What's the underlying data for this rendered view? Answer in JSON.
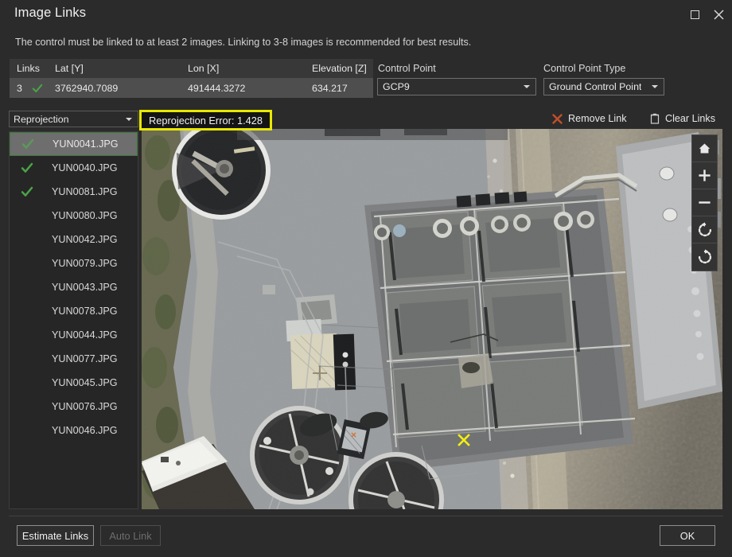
{
  "window": {
    "title": "Image Links",
    "maximize_icon": "maximize-icon",
    "close_icon": "close-icon"
  },
  "instruction": "The control must be linked to at least 2 images. Linking to 3-8 images is recommended for best results.",
  "table": {
    "headers": [
      "Links",
      "Lat [Y]",
      "Lon [X]",
      "Elevation [Z]"
    ],
    "row": {
      "links": "3",
      "lat": "3762940.7089",
      "lon": "491444.3272",
      "elevation": "634.217",
      "check_icon": "check-icon"
    }
  },
  "control_point": {
    "label": "Control Point",
    "value": "GCP9"
  },
  "control_point_type": {
    "label": "Control Point Type",
    "value": "Ground Control Point"
  },
  "toolbar": {
    "view_mode": "Reprojection",
    "reprojection_error": "Reprojection Error: 1.428",
    "remove_link": "Remove Link",
    "remove_link_icon": "x-mark-icon",
    "clear_links": "Clear Links",
    "clear_links_icon": "trash-icon"
  },
  "image_list": [
    {
      "name": "YUN0041.JPG",
      "linked": true,
      "selected": true
    },
    {
      "name": "YUN0040.JPG",
      "linked": true,
      "selected": false
    },
    {
      "name": "YUN0081.JPG",
      "linked": true,
      "selected": false
    },
    {
      "name": "YUN0080.JPG",
      "linked": false,
      "selected": false
    },
    {
      "name": "YUN0042.JPG",
      "linked": false,
      "selected": false
    },
    {
      "name": "YUN0079.JPG",
      "linked": false,
      "selected": false
    },
    {
      "name": "YUN0043.JPG",
      "linked": false,
      "selected": false
    },
    {
      "name": "YUN0078.JPG",
      "linked": false,
      "selected": false
    },
    {
      "name": "YUN0044.JPG",
      "linked": false,
      "selected": false
    },
    {
      "name": "YUN0077.JPG",
      "linked": false,
      "selected": false
    },
    {
      "name": "YUN0045.JPG",
      "linked": false,
      "selected": false
    },
    {
      "name": "YUN0076.JPG",
      "linked": false,
      "selected": false
    },
    {
      "name": "YUN0046.JPG",
      "linked": false,
      "selected": false
    }
  ],
  "viewer": {
    "nav_buttons": [
      "home-icon",
      "zoom-in-icon",
      "zoom-out-icon",
      "rotate-counterclockwise-icon",
      "rotate-clockwise-icon"
    ],
    "markers": {
      "control_point_marker": "x-marker",
      "control_point_marker_color": "#f2ee12",
      "reprojected_marker": "cross-marker"
    }
  },
  "footer": {
    "estimate_links": "Estimate Links",
    "auto_link": "Auto Link",
    "auto_link_disabled": true,
    "ok": "OK"
  },
  "colors": {
    "dialog_background": "#2b2b2b",
    "header_row": "#383838",
    "selected_row": "#4e4e4e",
    "check_green": "#4aa347",
    "highlight_yellow": "#e8e800",
    "remove_red": "#c0502a"
  }
}
